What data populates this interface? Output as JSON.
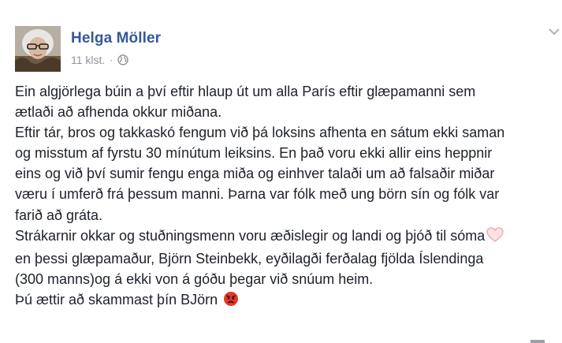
{
  "post": {
    "author": "Helga Möller",
    "time": "11 klst.",
    "separator": "·",
    "lines": [
      "Ein algjörlega búin a því eftir hlaup út um alla París eftir glæpamanni sem",
      "ætlaði að afhenda okkur miðana.",
      "Eftir tár, bros og takkaskó fengum við þá loksins afhenta en sátum ekki saman",
      "og misstum af fyrstu 30 mínútum leiksins. En það voru ekki allir eins heppnir",
      "eins og við því sumir fengu enga miða og einhver talaði um að falsaðir miðar",
      "væru í umferð frá þessum manni. Þarna var fólk með ung börn sín og fólk var",
      "farið að gráta.",
      "Strákarnir okkar og stuðningsmenn voru æðislegir og landi og þjóð til sóma",
      "en þessi glæpamaður, Björn Steinbekk, eyðilagði ferðalag fjölda Íslendinga",
      "(300 manns)og á ekki von á góðu þegar við snúum heim.",
      "Þú ættir að skammast þín BJörn"
    ],
    "emojis": {
      "heart": "pink-heart-icon",
      "angry": "angry-face-icon"
    }
  },
  "colors": {
    "author": "#365899",
    "meta": "#90949c",
    "text": "#1d2129"
  }
}
